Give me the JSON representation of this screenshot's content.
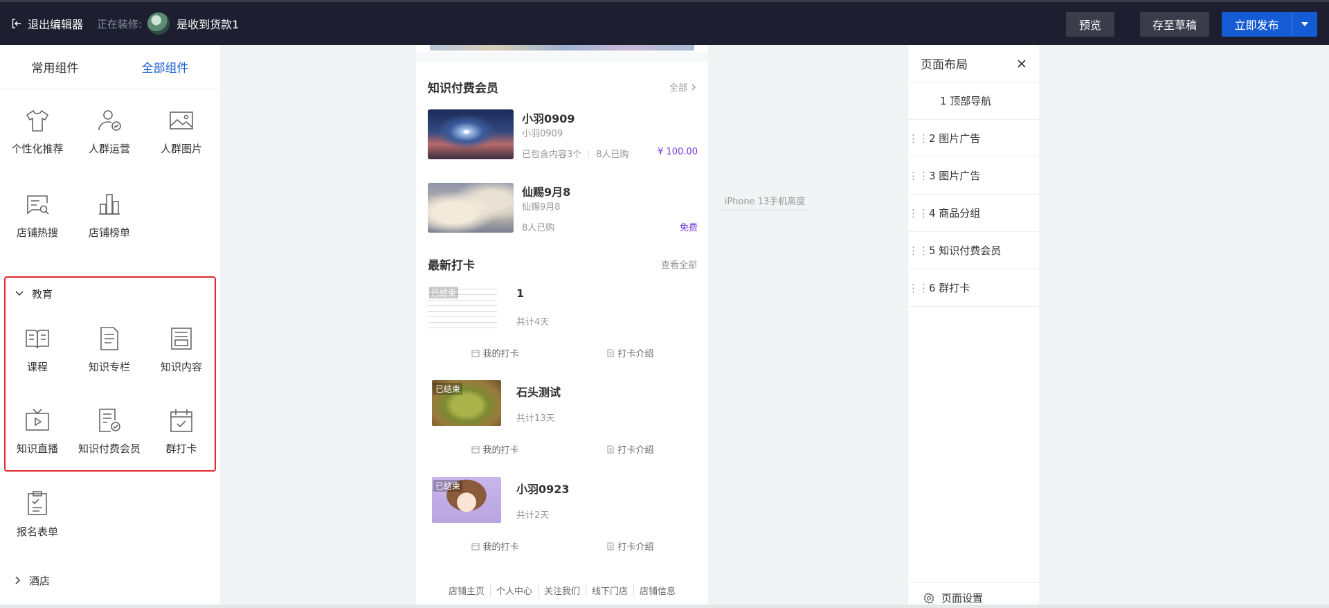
{
  "topbar": {
    "exit_label": "退出编辑器",
    "editing_label": "正在装修:",
    "shop_name": "是收到货款1",
    "preview_label": "预览",
    "draft_label": "存至草稿",
    "publish_label": "立即发布"
  },
  "left": {
    "tabs": [
      {
        "label": "常用组件",
        "active": false
      },
      {
        "label": "全部组件",
        "active": true
      }
    ],
    "top_items": [
      {
        "label": "个性化推荐",
        "icon": "tshirt-icon"
      },
      {
        "label": "人群运营",
        "icon": "user-chart-icon"
      },
      {
        "label": "人群图片",
        "icon": "image-icon"
      },
      {
        "label": "店铺热搜",
        "icon": "search-message-icon"
      },
      {
        "label": "店铺榜单",
        "icon": "bar-chart-icon"
      }
    ],
    "education_group": {
      "title": "教育",
      "items": [
        {
          "label": "课程",
          "icon": "book-icon"
        },
        {
          "label": "知识专栏",
          "icon": "document-icon"
        },
        {
          "label": "知识内容",
          "icon": "content-icon"
        },
        {
          "label": "知识直播",
          "icon": "tv-play-icon"
        },
        {
          "label": "知识付费会员",
          "icon": "member-doc-icon"
        },
        {
          "label": "群打卡",
          "icon": "calendar-check-icon"
        }
      ]
    },
    "form_item": {
      "label": "报名表单",
      "icon": "clipboard-icon"
    },
    "hotel_group": {
      "title": "酒店"
    }
  },
  "phone": {
    "membership": {
      "title": "知识付费会员",
      "more": "全部",
      "cards": [
        {
          "name": "小羽0909",
          "sub": "小羽0909",
          "meta1": "已包含内容3个",
          "meta2": "8人已购",
          "price": "¥ 100.00"
        },
        {
          "name": "仙赐9月8",
          "sub": "仙赐9月8",
          "meta1": "8人已购",
          "meta2": "",
          "price": "免费"
        }
      ]
    },
    "checkin": {
      "title": "最新打卡",
      "more": "查看全部",
      "tag": "已结束",
      "my_checkin": "我的打卡",
      "intro": "打卡介绍",
      "cards": [
        {
          "name": "1",
          "days": "共计4天"
        },
        {
          "name": "石头测试",
          "days": "共计13天"
        },
        {
          "name": "小羽0923",
          "days": "共计2天"
        }
      ]
    },
    "footer": [
      "店铺主页",
      "个人中心",
      "关注我们",
      "线下门店",
      "店铺信息"
    ]
  },
  "phone_height_label": "iPhone 13手机高度",
  "right": {
    "title": "页面布局",
    "items": [
      "1 顶部导航",
      "2 图片广告",
      "3 图片广告",
      "4 商品分组",
      "5 知识付费会员",
      "6 群打卡"
    ],
    "page_setting": "页面设置"
  },
  "colors": {
    "topbar_bg": "#1d1f30",
    "accent": "#155bd4",
    "highlight_border": "#e4272c",
    "price": "#7232dd"
  }
}
